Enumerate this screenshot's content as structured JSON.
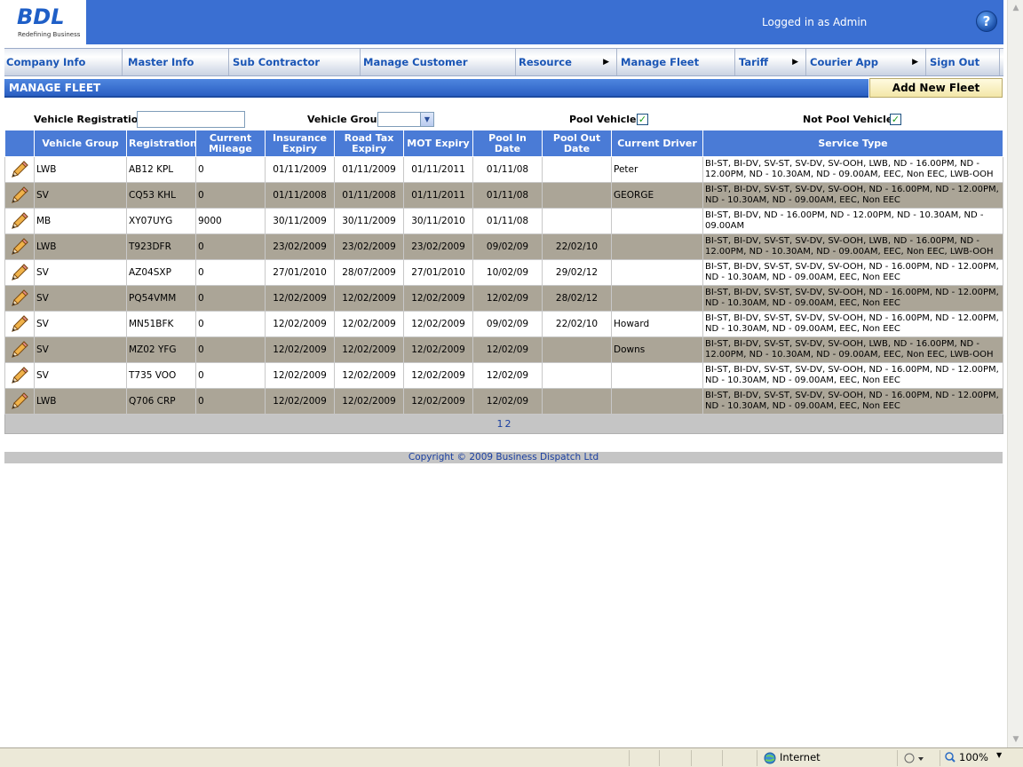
{
  "header": {
    "logo_text": "BDL",
    "logo_tagline": "Redefining Business",
    "logged_in": "Logged in as Admin",
    "help_label": "?"
  },
  "nav": [
    {
      "label": "Company Info",
      "arrow": false
    },
    {
      "label": "Master Info",
      "arrow": false
    },
    {
      "label": "Sub Contractor",
      "arrow": false
    },
    {
      "label": "Manage Customer",
      "arrow": false
    },
    {
      "label": "Resource",
      "arrow": true
    },
    {
      "label": "Manage Fleet",
      "arrow": false
    },
    {
      "label": "Tariff",
      "arrow": true
    },
    {
      "label": "Courier App",
      "arrow": true
    },
    {
      "label": "Sign Out",
      "arrow": false
    }
  ],
  "page": {
    "title": "MANAGE FLEET",
    "add_button": "Add New Fleet"
  },
  "filters": {
    "registration_label": "Vehicle Registration",
    "registration_value": "",
    "group_label": "Vehicle Group",
    "group_value": "",
    "pool_label": "Pool Vehicle",
    "pool_checked": true,
    "not_pool_label": "Not Pool Vehicle",
    "not_pool_checked": true
  },
  "table": {
    "headers": [
      "",
      "Vehicle Group",
      "Registration",
      "Current Mileage",
      "Insurance Expiry",
      "Road Tax Expiry",
      "MOT Expiry",
      "Pool In Date",
      "Pool Out Date",
      "Current Driver",
      "Service Type"
    ],
    "rows": [
      {
        "group": "LWB",
        "reg": "AB12 KPL",
        "mileage": "0",
        "insurance": "01/11/2009",
        "roadtax": "01/11/2009",
        "mot": "01/11/2011",
        "pool_in": "01/11/08",
        "pool_out": "",
        "driver": "Peter",
        "service": "BI-ST, BI-DV, SV-ST, SV-DV, SV-OOH, LWB, ND - 16.00PM, ND - 12.00PM, ND - 10.30AM, ND - 09.00AM, EEC, Non EEC, LWB-OOH"
      },
      {
        "group": "SV",
        "reg": "CQ53 KHL",
        "mileage": "0",
        "insurance": "01/11/2008",
        "roadtax": "01/11/2008",
        "mot": "01/11/2011",
        "pool_in": "01/11/08",
        "pool_out": "",
        "driver": "GEORGE",
        "service": "BI-ST, BI-DV, SV-ST, SV-DV, SV-OOH, ND - 16.00PM, ND - 12.00PM, ND - 10.30AM, ND - 09.00AM, EEC, Non EEC"
      },
      {
        "group": "MB",
        "reg": "XY07UYG",
        "mileage": "9000",
        "insurance": "30/11/2009",
        "roadtax": "30/11/2009",
        "mot": "30/11/2010",
        "pool_in": "01/11/08",
        "pool_out": "",
        "driver": "",
        "service": "BI-ST, BI-DV, ND - 16.00PM, ND - 12.00PM, ND - 10.30AM, ND - 09.00AM"
      },
      {
        "group": "LWB",
        "reg": "T923DFR",
        "mileage": "0",
        "insurance": "23/02/2009",
        "roadtax": "23/02/2009",
        "mot": "23/02/2009",
        "pool_in": "09/02/09",
        "pool_out": "22/02/10",
        "driver": "",
        "service": "BI-ST, BI-DV, SV-ST, SV-DV, SV-OOH, LWB, ND - 16.00PM, ND - 12.00PM, ND - 10.30AM, ND - 09.00AM, EEC, Non EEC, LWB-OOH"
      },
      {
        "group": "SV",
        "reg": "AZ04SXP",
        "mileage": "0",
        "insurance": "27/01/2010",
        "roadtax": "28/07/2009",
        "mot": "27/01/2010",
        "pool_in": "10/02/09",
        "pool_out": "29/02/12",
        "driver": "",
        "service": "BI-ST, BI-DV, SV-ST, SV-DV, SV-OOH, ND - 16.00PM, ND - 12.00PM, ND - 10.30AM, ND - 09.00AM, EEC, Non EEC"
      },
      {
        "group": "SV",
        "reg": "PQ54VMM",
        "mileage": "0",
        "insurance": "12/02/2009",
        "roadtax": "12/02/2009",
        "mot": "12/02/2009",
        "pool_in": "12/02/09",
        "pool_out": "28/02/12",
        "driver": "",
        "service": "BI-ST, BI-DV, SV-ST, SV-DV, SV-OOH, ND - 16.00PM, ND - 12.00PM, ND - 10.30AM, ND - 09.00AM, EEC, Non EEC"
      },
      {
        "group": "SV",
        "reg": "MN51BFK",
        "mileage": "0",
        "insurance": "12/02/2009",
        "roadtax": "12/02/2009",
        "mot": "12/02/2009",
        "pool_in": "09/02/09",
        "pool_out": "22/02/10",
        "driver": "Howard",
        "service": "BI-ST, BI-DV, SV-ST, SV-DV, SV-OOH, ND - 16.00PM, ND - 12.00PM, ND - 10.30AM, ND - 09.00AM, EEC, Non EEC"
      },
      {
        "group": "SV",
        "reg": "MZ02 YFG",
        "mileage": "0",
        "insurance": "12/02/2009",
        "roadtax": "12/02/2009",
        "mot": "12/02/2009",
        "pool_in": "12/02/09",
        "pool_out": "",
        "driver": "Downs",
        "service": "BI-ST, BI-DV, SV-ST, SV-DV, SV-OOH, LWB, ND - 16.00PM, ND - 12.00PM, ND - 10.30AM, ND - 09.00AM, EEC, Non EEC, LWB-OOH"
      },
      {
        "group": "SV",
        "reg": "T735 VOO",
        "mileage": "0",
        "insurance": "12/02/2009",
        "roadtax": "12/02/2009",
        "mot": "12/02/2009",
        "pool_in": "12/02/09",
        "pool_out": "",
        "driver": "",
        "service": "BI-ST, BI-DV, SV-ST, SV-DV, SV-OOH, ND - 16.00PM, ND - 12.00PM, ND - 10.30AM, ND - 09.00AM, EEC, Non EEC"
      },
      {
        "group": "LWB",
        "reg": "Q706 CRP",
        "mileage": "0",
        "insurance": "12/02/2009",
        "roadtax": "12/02/2009",
        "mot": "12/02/2009",
        "pool_in": "12/02/09",
        "pool_out": "",
        "driver": "",
        "service": "BI-ST, BI-DV, SV-ST, SV-DV, SV-OOH, ND - 16.00PM, ND - 12.00PM, ND - 10.30AM, ND - 09.00AM, EEC, Non EEC"
      }
    ],
    "pages": [
      "1",
      "2"
    ]
  },
  "footer": {
    "copyright": "Copyright © 2009 Business Dispatch Ltd"
  },
  "statusbar": {
    "zone": "Internet",
    "zoom": "100%"
  },
  "colors": {
    "brand_blue": "#3a6fd2",
    "header_blue": "#4a7bd6",
    "row_alt": "#aba597",
    "link_blue": "#1a55b5"
  }
}
